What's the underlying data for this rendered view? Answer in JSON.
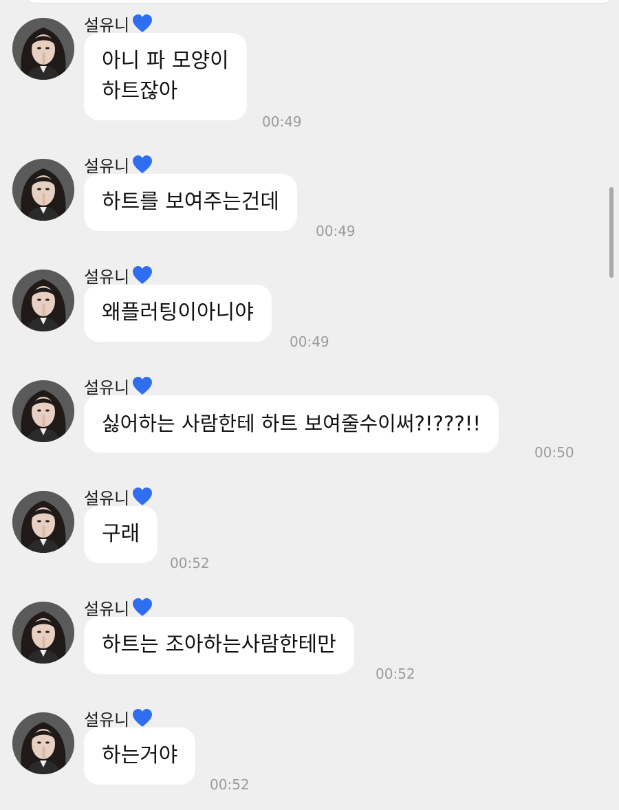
{
  "sender": "설유니",
  "heart_icon": "blue-heart-icon",
  "heart_color": "#2f6ef0",
  "messages": [
    {
      "text": "아니 파 모양이\n하트잖아",
      "time": "00:49"
    },
    {
      "text": "하트를 보여주는건데",
      "time": "00:49"
    },
    {
      "text": "왜플러팅이아니야",
      "time": "00:49"
    },
    {
      "text": "싫어하는 사람한테 하트 보여줄수이써?!???!!",
      "time": "00:50"
    },
    {
      "text": "구래",
      "time": "00:52"
    },
    {
      "text": "하트는 조아하는사람한테만",
      "time": "00:52"
    },
    {
      "text": "하는거야",
      "time": "00:52"
    }
  ]
}
